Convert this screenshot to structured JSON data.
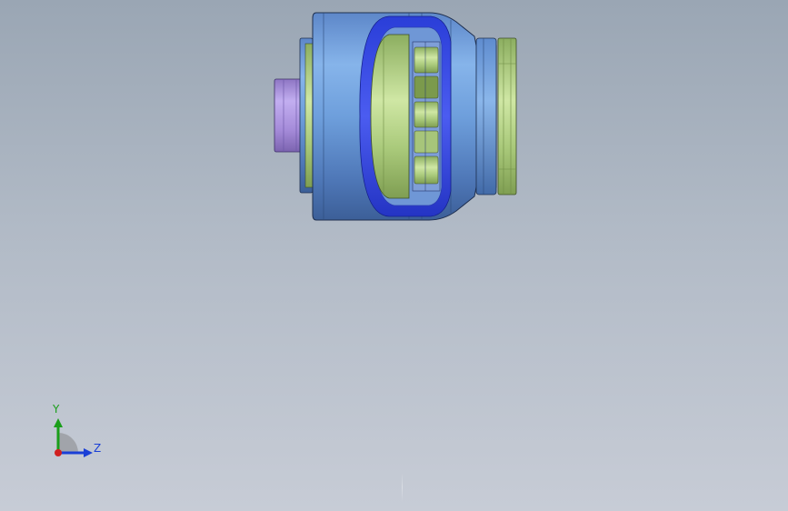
{
  "viewport": {
    "background_top": "#9aa6b4",
    "background_bottom": "#c7ccd6"
  },
  "model": {
    "body_color": "#6d9fdb",
    "highlight_color": "#3b49e6",
    "bearing_color": "#b9d98a",
    "shaft_color": "#a88fd6"
  },
  "triad": {
    "y_label": "Y",
    "z_label": "Z",
    "y_color": "#1a9e1a",
    "z_color": "#1a3fd6",
    "origin_color": "#d02020"
  }
}
